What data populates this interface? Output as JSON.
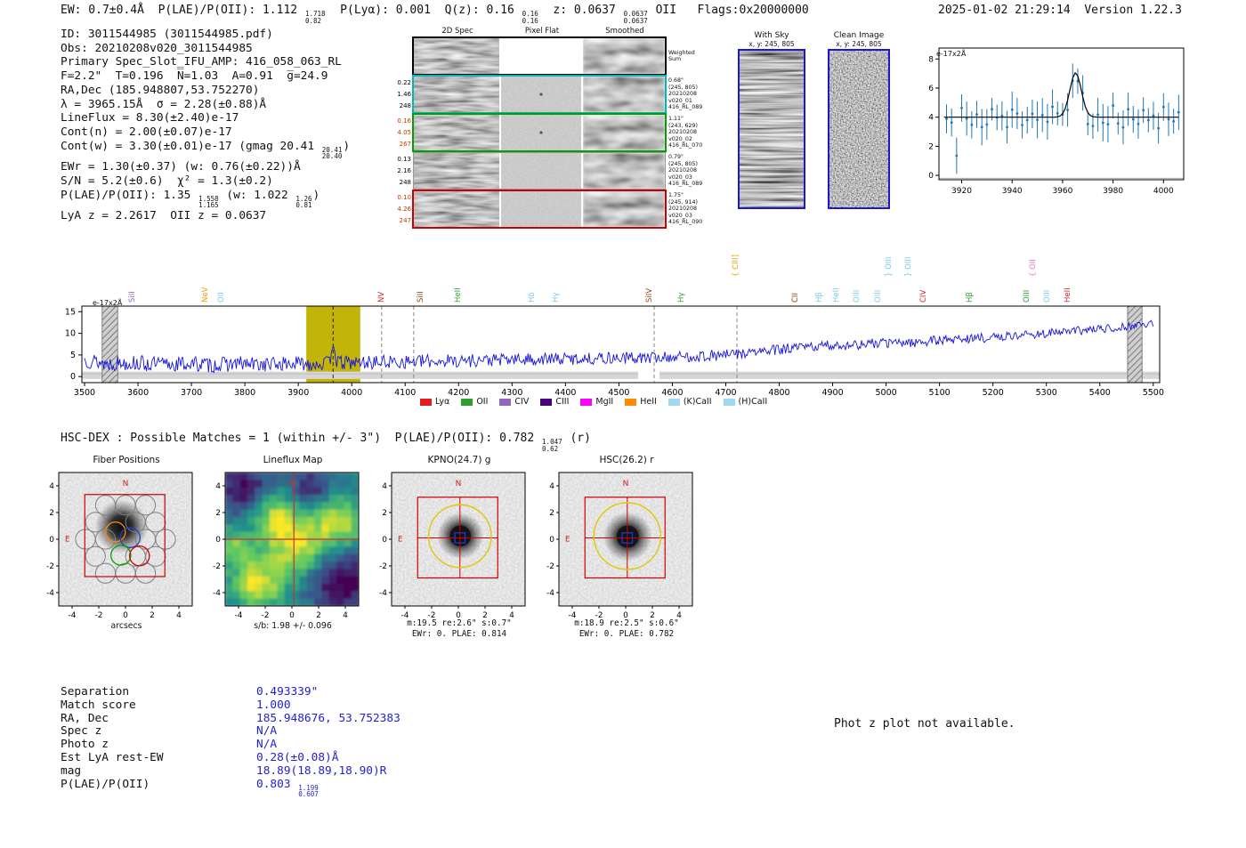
{
  "meta": {
    "timestamp": "2025-01-02 21:29:14  Version 1.22.3"
  },
  "header_segments": [
    {
      "t": "EW: 0.7±0.4Å  P(LAE)/P(OII): 1.112 "
    },
    {
      "frac": [
        "1.718",
        "0.82"
      ]
    },
    {
      "t": "  P(Lyα): 0.001  Q(z): 0.16 "
    },
    {
      "frac": [
        "0.16",
        "0.16"
      ]
    },
    {
      "t": "  z: 0.0637 "
    },
    {
      "frac": [
        "0.0637",
        "0.0637"
      ]
    },
    {
      "t": " OII   Flags:0x20000000"
    }
  ],
  "info_lines": [
    [
      {
        "t": "ID: 3011544985 (3011544985.pdf)"
      }
    ],
    [
      {
        "t": "Obs: 20210208v020_3011544985"
      }
    ],
    [
      {
        "t": "Primary Spec_Slot_IFU_AMP: 416_058_063_RL"
      }
    ],
    [
      {
        "t": "F=2.2\"  T=0.196  N̅=1.03  A=0.91  g̅=24.9"
      }
    ],
    [
      {
        "t": "RA,Dec (185.948807,53.752270)"
      }
    ],
    [
      {
        "t": "λ = 3965.15Å  σ = 2.28(±0.88)Å"
      }
    ],
    [
      {
        "t": "LineFlux = 8.30(±2.40)e-17"
      }
    ],
    [
      {
        "t": "Cont(n) = 2.00(±0.07)e-17"
      }
    ],
    [
      {
        "t": "Cont(w) = 3.30(±0.01)e-17 (gmag 20.41 "
      },
      {
        "frac": [
          "20.41",
          "20.40"
        ]
      },
      {
        "t": ")"
      }
    ],
    [
      {
        "t": "EWr = 1.30(±0.37) (w: 0.76(±0.22))Å"
      }
    ],
    [
      {
        "t": "S/N = 5.2(±0.6)  χ² = 1.3(±0.2)"
      }
    ],
    [
      {
        "t": "P(LAE)/P(OII): 1.35 "
      },
      {
        "frac": [
          "1.558",
          "1.165"
        ]
      },
      {
        "t": " (w: 1.022 "
      },
      {
        "frac": [
          "1.26",
          "0.81"
        ]
      },
      {
        "t": ")"
      }
    ],
    [
      {
        "t": "LyA z = 2.2617  OII z = 0.0637"
      }
    ]
  ],
  "cutouts": {
    "col_titles": [
      "2D Spec",
      "Pixel Flat",
      "Smoothed"
    ],
    "rows": [
      {
        "border": "#000000",
        "bw": 2,
        "nums": [],
        "nums_color": "#000000",
        "right": [
          "Weighted",
          "Sum"
        ],
        "flat": "blank",
        "bright": 0.9,
        "speck": false
      },
      {
        "border": "#00b7b7",
        "bw": 2,
        "nums": [
          "0.22",
          "1.46",
          "248"
        ],
        "nums_color": "#000000",
        "right": [
          "0.68\"",
          "(245, 805)",
          "20210208",
          "v020_01",
          "416_RL_089"
        ],
        "flat": "noise",
        "bright": 0.35,
        "speck": true
      },
      {
        "border": "#00a000",
        "bw": 2,
        "nums": [
          "0.16",
          "4.05",
          "267"
        ],
        "nums_color": "#cc3300",
        "right": [
          "1.11\"",
          "(243, 629)",
          "20210208",
          "v020_02",
          "416_RL_070"
        ],
        "flat": "noise",
        "bright": 0.5,
        "speck": true
      },
      {
        "border": "#999999",
        "bw": 1,
        "nums": [
          "0.13",
          "2.16",
          "248"
        ],
        "nums_color": "#000000",
        "right": [
          "0.79\"",
          "(245, 805)",
          "20210208",
          "v020_03",
          "416_RL_089"
        ],
        "flat": "noise",
        "bright": 0.3,
        "speck": false
      },
      {
        "border": "#cc0000",
        "bw": 2,
        "nums": [
          "0.10",
          "4.26",
          "247"
        ],
        "nums_color": "#cc3300",
        "right": [
          "1.75\"",
          "(245, 914)",
          "20210208",
          "v020_03",
          "416_RL_090"
        ],
        "flat": "noise",
        "bright": 0.15,
        "speck": false
      }
    ]
  },
  "withsky": {
    "title": "With Sky",
    "xy": "x, y: 245, 805"
  },
  "clean": {
    "title": "Clean Image",
    "xy": "x, y: 245, 805"
  },
  "hsc_segments": [
    {
      "t": "HSC-DEX : Possible Matches = 1 (within +/- 3\")  P(LAE)/P(OII): 0.782 "
    },
    {
      "frac": [
        "1.047",
        "0.62"
      ]
    },
    {
      "t": " (r)"
    }
  ],
  "panels": [
    {
      "title": "Fiber Positions",
      "captions": [
        "arcsecs"
      ]
    },
    {
      "title": "Lineflux Map",
      "captions": [
        "s/b: 1.98 +/- 0.096"
      ]
    },
    {
      "title": "KPNO(24.7) g",
      "captions": [
        "m:19.5 re:2.6\" s:0.7\"",
        "EWr: 0. PLAE: 0.814"
      ]
    },
    {
      "title": "HSC(26.2) r",
      "captions": [
        "m:18.9 re:2.5\" s:0.6\"",
        "EWr: 0. PLAE: 0.782"
      ]
    }
  ],
  "compass": {
    "n": "N",
    "e": "E"
  },
  "match": {
    "rows": [
      {
        "label": "Separation",
        "value": [
          {
            "t": "0.493339\""
          }
        ]
      },
      {
        "label": "Match score",
        "value": [
          {
            "t": "1.000"
          }
        ]
      },
      {
        "label": "RA, Dec",
        "value": [
          {
            "t": "185.948676, 53.752383"
          }
        ]
      },
      {
        "label": "Spec z",
        "value": [
          {
            "t": "N/A"
          }
        ]
      },
      {
        "label": "Photo z",
        "value": [
          {
            "t": "N/A"
          }
        ]
      },
      {
        "label": "Est LyA rest-EW",
        "value": [
          {
            "t": "0.28(±0.08)Å"
          }
        ]
      },
      {
        "label": "mag",
        "value": [
          {
            "t": "18.89(18.89,18.90)R"
          }
        ]
      },
      {
        "label": "P(LAE)/P(OII)",
        "value": [
          {
            "t": "0.803 "
          },
          {
            "frac": [
              "1.199",
              "0.607"
            ]
          }
        ]
      }
    ]
  },
  "photz_note": "Phot z plot not available.",
  "chart_data": [
    {
      "id": "zoom_spectrum",
      "type": "scatter",
      "ylabel": "e-17x2Å",
      "xlim": [
        3911,
        4008
      ],
      "ylim": [
        -0.3,
        8.75
      ],
      "xticks": [
        3920,
        3940,
        3960,
        3980,
        4000
      ],
      "yticks": [
        0,
        2,
        4,
        6,
        8
      ],
      "color": "#1f77b4",
      "continuum": 4.0,
      "gauss": {
        "center": 3965.15,
        "sigma": 2.28,
        "amplitude": 3.05
      },
      "x_start": 3914,
      "x_end": 4006,
      "x_step": 2,
      "scatter": 1.7,
      "err_base": 0.75,
      "err_var": 0.55,
      "seed": 21,
      "low_point": [
        3918,
        1.35
      ],
      "baseline": -0.2
    },
    {
      "id": "full_spectrum",
      "type": "line",
      "ylabel": "e-17x2Å",
      "xlim": [
        3495,
        5512
      ],
      "ylim": [
        -1.4,
        16.3
      ],
      "xticks": [
        3500,
        3600,
        3700,
        3800,
        3900,
        4000,
        4100,
        4200,
        4300,
        4400,
        4500,
        4600,
        4700,
        4800,
        4900,
        5000,
        5100,
        5200,
        5300,
        5400,
        5500
      ],
      "yticks": [
        0,
        5,
        10,
        15
      ],
      "line_color": "#1515dd",
      "seed": 13,
      "noise_start": 1.9,
      "noise_end": 0.9,
      "peak": {
        "center": 3965.15,
        "sigma": 3.0,
        "amp": 5.2
      },
      "anchors": [
        [
          3500,
          4.0
        ],
        [
          3540,
          3.0
        ],
        [
          3580,
          3.3
        ],
        [
          3620,
          2.9
        ],
        [
          3660,
          2.8
        ],
        [
          3700,
          3.0
        ],
        [
          3740,
          2.6
        ],
        [
          3780,
          3.0
        ],
        [
          3820,
          2.8
        ],
        [
          3860,
          2.9
        ],
        [
          3900,
          3.0
        ],
        [
          3940,
          3.0
        ],
        [
          3965,
          3.1
        ],
        [
          4000,
          3.2
        ],
        [
          4040,
          3.3
        ],
        [
          4080,
          3.4
        ],
        [
          4120,
          3.5
        ],
        [
          4160,
          3.6
        ],
        [
          4200,
          3.7
        ],
        [
          4250,
          3.8
        ],
        [
          4300,
          3.9
        ],
        [
          4350,
          4.0
        ],
        [
          4400,
          4.1
        ],
        [
          4450,
          4.2
        ],
        [
          4500,
          4.3
        ],
        [
          4550,
          4.35
        ],
        [
          4600,
          4.5
        ],
        [
          4650,
          4.7
        ],
        [
          4700,
          5.0
        ],
        [
          4750,
          5.6
        ],
        [
          4800,
          6.2
        ],
        [
          4850,
          6.8
        ],
        [
          4900,
          7.2
        ],
        [
          4950,
          7.4
        ],
        [
          5000,
          7.8
        ],
        [
          5050,
          7.9
        ],
        [
          5100,
          8.4
        ],
        [
          5150,
          8.8
        ],
        [
          5200,
          9.0
        ],
        [
          5250,
          9.6
        ],
        [
          5300,
          10.0
        ],
        [
          5350,
          10.5
        ],
        [
          5400,
          11.0
        ],
        [
          5450,
          11.6
        ],
        [
          5500,
          12.4
        ]
      ],
      "emission_band": {
        "from": 3915,
        "to": 4016,
        "color": "#c3b40a"
      },
      "hatch_bands": [
        [
          3533,
          3562
        ],
        [
          5452,
          5479
        ]
      ],
      "dashed_gray": [
        4056,
        4116,
        4566,
        4721
      ],
      "dashed_black": [
        3965.15
      ],
      "strip": {
        "v_top": 1.15,
        "v_bot": -0.55,
        "gap": [
          4536,
          4576
        ],
        "color": "#d6d6d6"
      },
      "line_labels": [
        {
          "text": "SiII",
          "wave": 3605,
          "color": "#9467bd",
          "raised": 0
        },
        {
          "text": "NeV",
          "wave": 3742,
          "color": "#e8a000",
          "raised": 0
        },
        {
          "text": "OII",
          "wave": 3772,
          "color": "#79c8e8",
          "raised": 0
        },
        {
          "text": "NV",
          "wave": 4072,
          "color": "#d62728",
          "raised": 0
        },
        {
          "text": "SiII",
          "wave": 4145,
          "color": "#8b4513",
          "raised": 0
        },
        {
          "text": "HeII",
          "wave": 4215,
          "color": "#2ca02c",
          "raised": 0
        },
        {
          "text": "Hδ",
          "wave": 4352,
          "color": "#79c8e8",
          "raised": 0
        },
        {
          "text": "Hγ",
          "wave": 4398,
          "color": "#79c8e8",
          "raised": 0
        },
        {
          "text": "SiIV",
          "wave": 4573,
          "color": "#8b4513",
          "raised": 0
        },
        {
          "text": "Hγ",
          "wave": 4632,
          "color": "#2ca02c",
          "raised": 0
        },
        {
          "text": "{ CIII]",
          "wave": 4735,
          "color": "#e8a000",
          "raised": 1
        },
        {
          "text": "CII",
          "wave": 4845,
          "color": "#8b4513",
          "raised": 0
        },
        {
          "text": "Hβ",
          "wave": 4890,
          "color": "#79c8e8",
          "raised": 0
        },
        {
          "text": "HeII",
          "wave": 4922,
          "color": "#79c8e8",
          "raised": 0
        },
        {
          "text": "OIII",
          "wave": 4960,
          "color": "#79c8e8",
          "raised": 0
        },
        {
          "text": "OIII",
          "wave": 5000,
          "color": "#79c8e8",
          "raised": 0
        },
        {
          "text": "} OIII",
          "wave": 5020,
          "color": "#79c8e8",
          "raised": 1
        },
        {
          "text": "} OIII",
          "wave": 5058,
          "color": "#79c8e8",
          "raised": 1
        },
        {
          "text": "CIV",
          "wave": 5085,
          "color": "#d62728",
          "raised": 0
        },
        {
          "text": "Hβ",
          "wave": 5172,
          "color": "#2ca02c",
          "raised": 0
        },
        {
          "text": "OIII",
          "wave": 5278,
          "color": "#2ca02c",
          "raised": 0
        },
        {
          "text": "{ OII",
          "wave": 5290,
          "color": "#e377c2",
          "raised": 1
        },
        {
          "text": "OIII",
          "wave": 5317,
          "color": "#79c8e8",
          "raised": 0
        },
        {
          "text": "HeII",
          "wave": 5355,
          "color": "#d62728",
          "raised": 0
        }
      ],
      "legend": [
        {
          "label": "Lyα",
          "color": "#e41a1c"
        },
        {
          "label": "OII",
          "color": "#2ca02c"
        },
        {
          "label": "CIV",
          "color": "#9467bd"
        },
        {
          "label": "CIII",
          "color": "#4b0082"
        },
        {
          "label": "MgII",
          "color": "#ff00ff"
        },
        {
          "label": "HeII",
          "color": "#ff8c00"
        },
        {
          "label": "(K)CaII",
          "color": "#9fd8ef"
        },
        {
          "label": "(H)CaII",
          "color": "#9fd8ef"
        }
      ]
    }
  ],
  "graphics": {
    "viridis": [
      [
        0,
        "#440154"
      ],
      [
        0.25,
        "#3b528b"
      ],
      [
        0.5,
        "#21918c"
      ],
      [
        0.75,
        "#5ec962"
      ],
      [
        1,
        "#fde725"
      ]
    ],
    "fiber_positions": {
      "r": 0.74,
      "gray": [
        [
          -1.5,
          2.55
        ],
        [
          0,
          2.55
        ],
        [
          1.5,
          2.55
        ],
        [
          -2.25,
          1.28
        ],
        [
          0.75,
          1.28
        ],
        [
          2.25,
          1.28
        ],
        [
          -3.0,
          0.0
        ],
        [
          -1.5,
          0.0
        ],
        [
          1.5,
          0.0
        ],
        [
          3.0,
          0.0
        ],
        [
          -2.25,
          -1.28
        ],
        [
          0.75,
          -1.28
        ],
        [
          2.25,
          -1.28
        ],
        [
          -1.5,
          -2.55
        ],
        [
          0,
          -2.55
        ],
        [
          1.5,
          -2.55
        ]
      ],
      "colored": [
        [
          -0.75,
          0.55,
          "#ff8c00"
        ],
        [
          0.35,
          0.12,
          "#1f3fd0"
        ],
        [
          -0.35,
          -1.2,
          "#00a000"
        ],
        [
          1.05,
          -1.25,
          "#cc0000"
        ]
      ],
      "box": [
        -3.05,
        -2.8,
        2.95,
        3.35
      ],
      "blob": [
        -0.3,
        0.95,
        2.0
      ]
    },
    "lineflux": {
      "bright": [
        [
          -2.6,
          -3.4,
          1.3,
          0.55
        ],
        [
          0.2,
          -0.6,
          1.5,
          0.5
        ],
        [
          -1.2,
          1.8,
          1.2,
          0.45
        ],
        [
          3.3,
          1.2,
          1.4,
          0.5
        ],
        [
          -4.2,
          -0.5,
          1.0,
          0.35
        ]
      ],
      "dark": [
        [
          -3.6,
          3.8,
          1.4,
          0.4
        ],
        [
          3.8,
          -3.2,
          1.6,
          0.45
        ],
        [
          1.5,
          3.8,
          1.2,
          0.3
        ]
      ],
      "cross": [
        0.15,
        0.0
      ],
      "noise": 0.16,
      "seed": 9
    },
    "kpno": {
      "blob": [
        0.15,
        0.25,
        1.75
      ],
      "aperture_r": 2.35,
      "cross": [
        0.12,
        0.1
      ],
      "box": [
        -3.05,
        -2.9,
        2.95,
        3.15
      ],
      "blue_half": 0.38,
      "aperture_color": "#e3c800"
    },
    "hsc": {
      "blob": [
        0.15,
        0.2,
        1.85
      ],
      "aperture_r": 2.5,
      "cross": [
        0.12,
        0.1
      ],
      "box": [
        -3.05,
        -2.9,
        2.95,
        3.15
      ],
      "blue_half": 0.38,
      "aperture_color": "#e3c800"
    }
  }
}
